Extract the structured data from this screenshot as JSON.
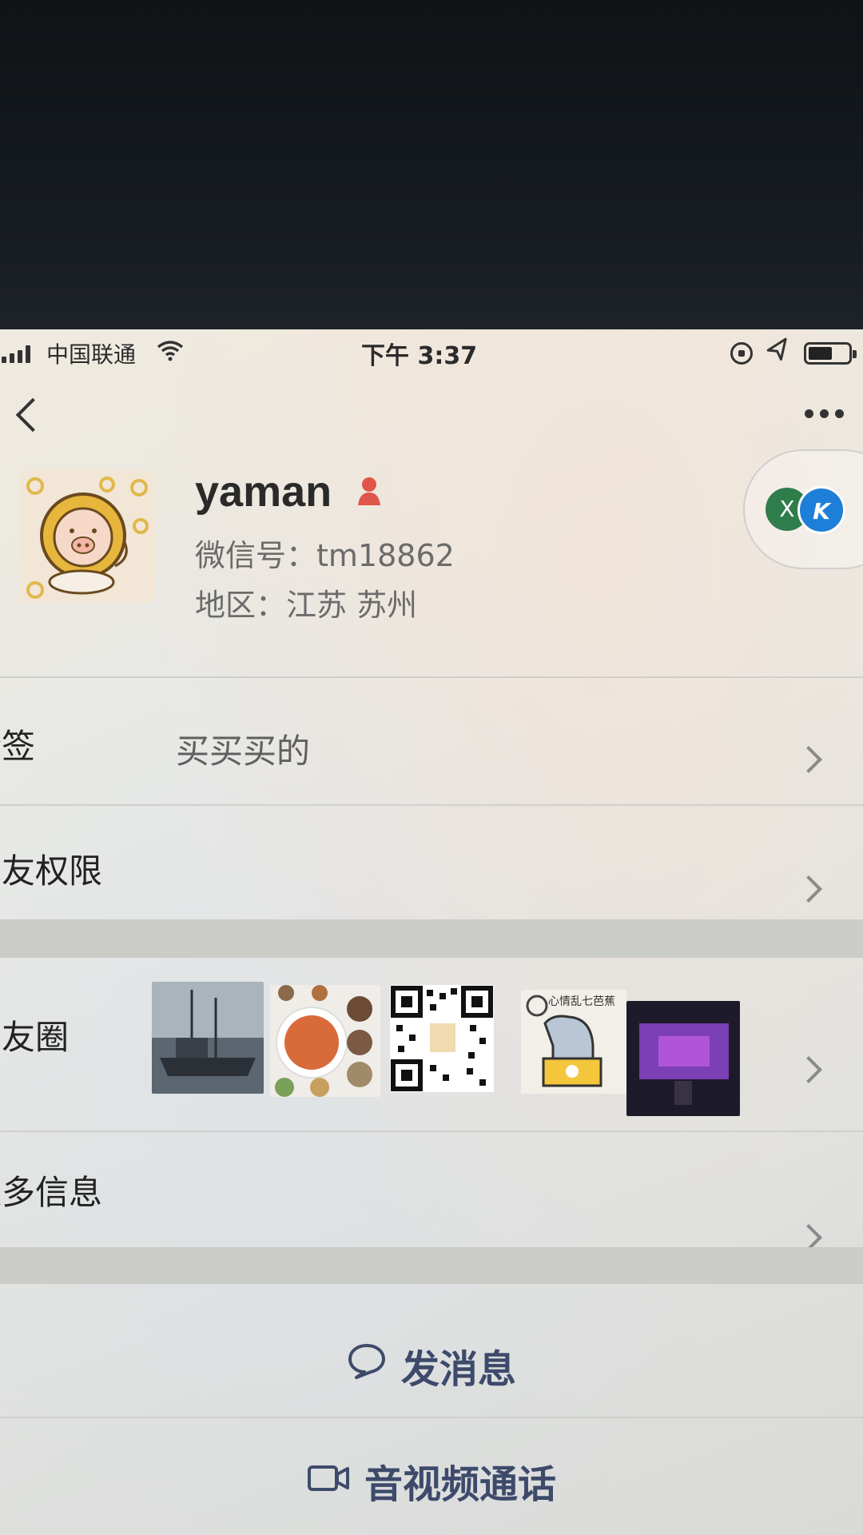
{
  "status_bar": {
    "carrier": "中国联通",
    "time": "下午 3:37"
  },
  "profile": {
    "name": "yaman",
    "wechat_id": "微信号：tm18862",
    "region": "地区：江苏 苏州"
  },
  "status_pill": {
    "left_badge": "X",
    "right_badge": "K"
  },
  "rows": {
    "tag": {
      "label": "标签",
      "value": "买买买的"
    },
    "friend_permissions": {
      "label": "朋友权限"
    },
    "moments": {
      "label": "朋友圈",
      "photos": [
        {
          "name": "harbor-boat"
        },
        {
          "name": "food-dishes"
        },
        {
          "name": "qr-code"
        },
        {
          "name": "sticker-cartoon",
          "caption": "心情乱七芭蕉"
        },
        {
          "name": "concert-stage"
        }
      ]
    },
    "more_info": {
      "label": "更多信息"
    }
  },
  "actions": {
    "send_message": "发消息",
    "video_call": "音视频通话"
  },
  "colors": {
    "action_text": "#3d4a6b",
    "gender_icon": "#e0554a"
  }
}
